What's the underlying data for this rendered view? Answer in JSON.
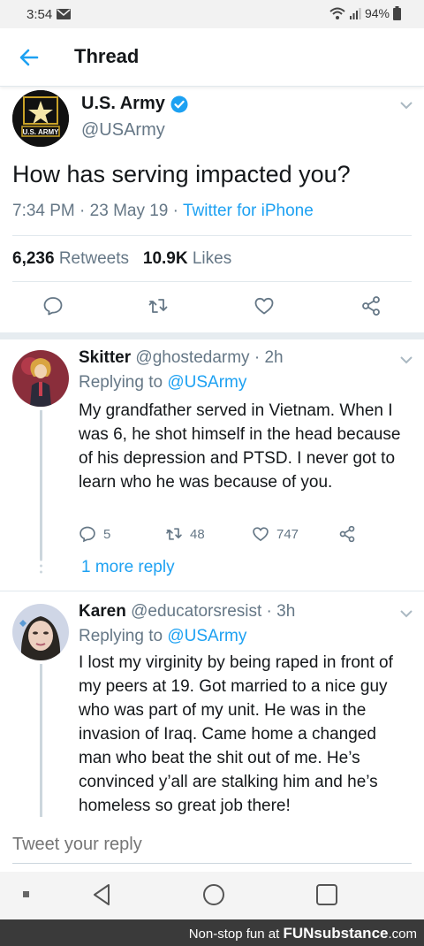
{
  "status_bar": {
    "time": "3:54",
    "battery": "94%",
    "icons": [
      "mail-icon",
      "wifi-icon",
      "signal-icon",
      "battery-icon"
    ]
  },
  "header": {
    "title": "Thread",
    "back_icon": "arrow-left-icon"
  },
  "accent_color": "#1da1f2",
  "main_tweet": {
    "name": "U.S. Army",
    "handle": "@USArmy",
    "avatar_label": "U.S. ARMY",
    "text": "How has serving impacted you?",
    "time": "7:34 PM",
    "date": "23 May 19",
    "source": "Twitter for iPhone",
    "retweets_count": "6,236",
    "retweets_label": "Retweets",
    "likes_count": "10.9K",
    "likes_label": "Likes"
  },
  "replies": [
    {
      "name": "Skitter",
      "handle": "@ghostedarmy",
      "age": "2h",
      "replying_label": "Replying to",
      "replying_to": "@USArmy",
      "text": "My grandfather served in Vietnam. When I was 6, he shot himself in the head because of his depression and PTSD. I never got to learn who he was because of you.",
      "replies": "5",
      "retweets": "48",
      "likes": "747",
      "more_replies": "1 more reply"
    },
    {
      "name": "Karen",
      "handle": "@educatorsresist",
      "age": "3h",
      "replying_label": "Replying to",
      "replying_to": "@USArmy",
      "text": "I lost my virginity by being raped in front of my peers at 19. Got married to a nice guy who was part of my unit. He was in the invasion of Iraq. Came home a changed man who beat the shit out of me. He’s convinced y’all are stalking him and he’s homeless so great job there!"
    }
  ],
  "compose": {
    "placeholder": "Tweet your reply"
  },
  "footer": {
    "text": "Non-stop fun at",
    "brand": "FUNsubstance",
    "suffix": ".com"
  }
}
